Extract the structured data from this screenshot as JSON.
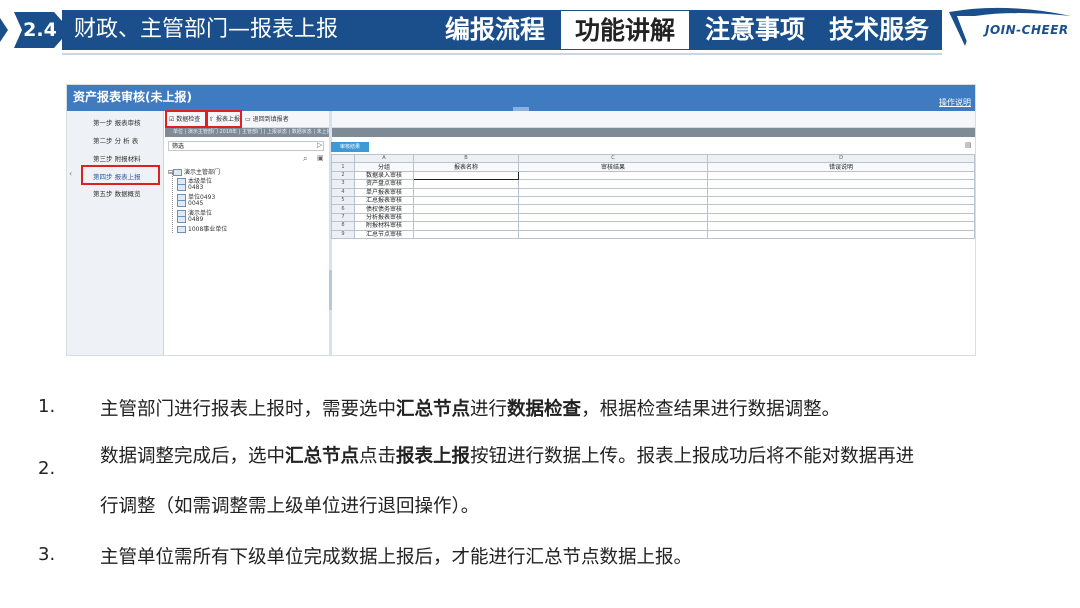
{
  "header": {
    "section_number": "2.4",
    "section_title": "财政、主管部门—报表上报",
    "nav": [
      {
        "label": "编报流程",
        "active": false
      },
      {
        "label": "功能讲解",
        "active": true
      },
      {
        "label": "注意事项",
        "active": false
      },
      {
        "label": "技术服务",
        "active": false
      }
    ],
    "logo_text": "JOIN-CHEER",
    "colors": {
      "brand": "#1a4f8b",
      "accent": "#3e7bc1",
      "highlight": "#e02020"
    }
  },
  "screenshot": {
    "title": "资产报表审核(未上报)",
    "help_link": "操作说明",
    "steps": [
      {
        "label": "第一步 报表审核",
        "selected": false
      },
      {
        "label": "第二步 分 析 表",
        "selected": false
      },
      {
        "label": "第三步 附报材料",
        "selected": false
      },
      {
        "label": "第四步 报表上报",
        "selected": true
      },
      {
        "label": "第五步 数据概览",
        "selected": false
      }
    ],
    "toolbar": {
      "check_label": "数据检查",
      "submit_label": "报表上报",
      "return_label": "退回到填报者"
    },
    "breadcrumb": "单位 | 演示主管部门  2018年 | 主管部门 | 上报状态 | 数据状态 | 未上报",
    "filter_placeholder": "筛选",
    "tree": {
      "root": "演示主管部门",
      "children": [
        "本级单位",
        "0483",
        "单位0493",
        "0045",
        "演示单位",
        "0489",
        "1008事业单位"
      ]
    },
    "tab_label": "审核结果",
    "grid": {
      "column_letters": [
        "A",
        "B",
        "C",
        "D"
      ],
      "headers": [
        "分组",
        "报表名称",
        "审核结果",
        "错误说明"
      ],
      "rows": [
        "数据录入审核",
        "资产盘点审核",
        "单户报表审核",
        "汇总报表审核",
        "债权债务审核",
        "分析报表审核",
        "附报材料审核",
        "汇总节点审核"
      ]
    }
  },
  "items": [
    {
      "number": "1.",
      "segments": [
        {
          "text": "主管部门进行报表上报时，需要选中",
          "bold": false
        },
        {
          "text": "汇总节点",
          "bold": true
        },
        {
          "text": "进行",
          "bold": false
        },
        {
          "text": "数据检查",
          "bold": true
        },
        {
          "text": "，根据检查结果进行数据调整。",
          "bold": false
        }
      ]
    },
    {
      "number": "2.",
      "segments": [
        {
          "text": "数据调整完成后，选中",
          "bold": false
        },
        {
          "text": "汇总节点",
          "bold": true
        },
        {
          "text": "点击",
          "bold": false
        },
        {
          "text": "报表上报",
          "bold": true
        },
        {
          "text": "按钮进行数据上传。报表上报成功后将不能对数据再进",
          "bold": false
        }
      ],
      "continuation": "行调整（如需调整需上级单位进行退回操作）。"
    },
    {
      "number": "3.",
      "segments": [
        {
          "text": "主管单位需所有下级单位完成数据上报后，才能进行汇总节点数据上报。",
          "bold": false
        }
      ]
    }
  ]
}
